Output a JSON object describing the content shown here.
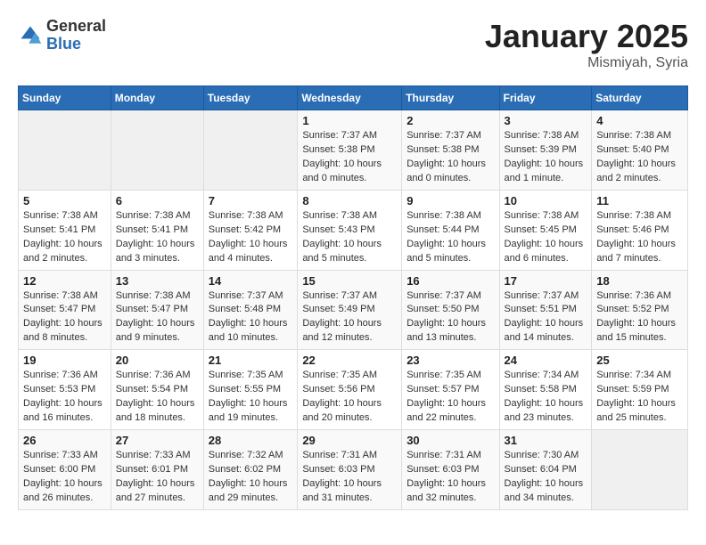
{
  "logo": {
    "general": "General",
    "blue": "Blue"
  },
  "title": "January 2025",
  "subtitle": "Mismiyah, Syria",
  "weekdays": [
    "Sunday",
    "Monday",
    "Tuesday",
    "Wednesday",
    "Thursday",
    "Friday",
    "Saturday"
  ],
  "weeks": [
    [
      {
        "empty": true
      },
      {
        "empty": true
      },
      {
        "empty": true
      },
      {
        "day": "1",
        "sunrise": "Sunrise: 7:37 AM",
        "sunset": "Sunset: 5:38 PM",
        "daylight": "Daylight: 10 hours and 0 minutes."
      },
      {
        "day": "2",
        "sunrise": "Sunrise: 7:37 AM",
        "sunset": "Sunset: 5:38 PM",
        "daylight": "Daylight: 10 hours and 0 minutes."
      },
      {
        "day": "3",
        "sunrise": "Sunrise: 7:38 AM",
        "sunset": "Sunset: 5:39 PM",
        "daylight": "Daylight: 10 hours and 1 minute."
      },
      {
        "day": "4",
        "sunrise": "Sunrise: 7:38 AM",
        "sunset": "Sunset: 5:40 PM",
        "daylight": "Daylight: 10 hours and 2 minutes."
      }
    ],
    [
      {
        "day": "5",
        "sunrise": "Sunrise: 7:38 AM",
        "sunset": "Sunset: 5:41 PM",
        "daylight": "Daylight: 10 hours and 2 minutes."
      },
      {
        "day": "6",
        "sunrise": "Sunrise: 7:38 AM",
        "sunset": "Sunset: 5:41 PM",
        "daylight": "Daylight: 10 hours and 3 minutes."
      },
      {
        "day": "7",
        "sunrise": "Sunrise: 7:38 AM",
        "sunset": "Sunset: 5:42 PM",
        "daylight": "Daylight: 10 hours and 4 minutes."
      },
      {
        "day": "8",
        "sunrise": "Sunrise: 7:38 AM",
        "sunset": "Sunset: 5:43 PM",
        "daylight": "Daylight: 10 hours and 5 minutes."
      },
      {
        "day": "9",
        "sunrise": "Sunrise: 7:38 AM",
        "sunset": "Sunset: 5:44 PM",
        "daylight": "Daylight: 10 hours and 5 minutes."
      },
      {
        "day": "10",
        "sunrise": "Sunrise: 7:38 AM",
        "sunset": "Sunset: 5:45 PM",
        "daylight": "Daylight: 10 hours and 6 minutes."
      },
      {
        "day": "11",
        "sunrise": "Sunrise: 7:38 AM",
        "sunset": "Sunset: 5:46 PM",
        "daylight": "Daylight: 10 hours and 7 minutes."
      }
    ],
    [
      {
        "day": "12",
        "sunrise": "Sunrise: 7:38 AM",
        "sunset": "Sunset: 5:47 PM",
        "daylight": "Daylight: 10 hours and 8 minutes."
      },
      {
        "day": "13",
        "sunrise": "Sunrise: 7:38 AM",
        "sunset": "Sunset: 5:47 PM",
        "daylight": "Daylight: 10 hours and 9 minutes."
      },
      {
        "day": "14",
        "sunrise": "Sunrise: 7:37 AM",
        "sunset": "Sunset: 5:48 PM",
        "daylight": "Daylight: 10 hours and 10 minutes."
      },
      {
        "day": "15",
        "sunrise": "Sunrise: 7:37 AM",
        "sunset": "Sunset: 5:49 PM",
        "daylight": "Daylight: 10 hours and 12 minutes."
      },
      {
        "day": "16",
        "sunrise": "Sunrise: 7:37 AM",
        "sunset": "Sunset: 5:50 PM",
        "daylight": "Daylight: 10 hours and 13 minutes."
      },
      {
        "day": "17",
        "sunrise": "Sunrise: 7:37 AM",
        "sunset": "Sunset: 5:51 PM",
        "daylight": "Daylight: 10 hours and 14 minutes."
      },
      {
        "day": "18",
        "sunrise": "Sunrise: 7:36 AM",
        "sunset": "Sunset: 5:52 PM",
        "daylight": "Daylight: 10 hours and 15 minutes."
      }
    ],
    [
      {
        "day": "19",
        "sunrise": "Sunrise: 7:36 AM",
        "sunset": "Sunset: 5:53 PM",
        "daylight": "Daylight: 10 hours and 16 minutes."
      },
      {
        "day": "20",
        "sunrise": "Sunrise: 7:36 AM",
        "sunset": "Sunset: 5:54 PM",
        "daylight": "Daylight: 10 hours and 18 minutes."
      },
      {
        "day": "21",
        "sunrise": "Sunrise: 7:35 AM",
        "sunset": "Sunset: 5:55 PM",
        "daylight": "Daylight: 10 hours and 19 minutes."
      },
      {
        "day": "22",
        "sunrise": "Sunrise: 7:35 AM",
        "sunset": "Sunset: 5:56 PM",
        "daylight": "Daylight: 10 hours and 20 minutes."
      },
      {
        "day": "23",
        "sunrise": "Sunrise: 7:35 AM",
        "sunset": "Sunset: 5:57 PM",
        "daylight": "Daylight: 10 hours and 22 minutes."
      },
      {
        "day": "24",
        "sunrise": "Sunrise: 7:34 AM",
        "sunset": "Sunset: 5:58 PM",
        "daylight": "Daylight: 10 hours and 23 minutes."
      },
      {
        "day": "25",
        "sunrise": "Sunrise: 7:34 AM",
        "sunset": "Sunset: 5:59 PM",
        "daylight": "Daylight: 10 hours and 25 minutes."
      }
    ],
    [
      {
        "day": "26",
        "sunrise": "Sunrise: 7:33 AM",
        "sunset": "Sunset: 6:00 PM",
        "daylight": "Daylight: 10 hours and 26 minutes."
      },
      {
        "day": "27",
        "sunrise": "Sunrise: 7:33 AM",
        "sunset": "Sunset: 6:01 PM",
        "daylight": "Daylight: 10 hours and 27 minutes."
      },
      {
        "day": "28",
        "sunrise": "Sunrise: 7:32 AM",
        "sunset": "Sunset: 6:02 PM",
        "daylight": "Daylight: 10 hours and 29 minutes."
      },
      {
        "day": "29",
        "sunrise": "Sunrise: 7:31 AM",
        "sunset": "Sunset: 6:03 PM",
        "daylight": "Daylight: 10 hours and 31 minutes."
      },
      {
        "day": "30",
        "sunrise": "Sunrise: 7:31 AM",
        "sunset": "Sunset: 6:03 PM",
        "daylight": "Daylight: 10 hours and 32 minutes."
      },
      {
        "day": "31",
        "sunrise": "Sunrise: 7:30 AM",
        "sunset": "Sunset: 6:04 PM",
        "daylight": "Daylight: 10 hours and 34 minutes."
      },
      {
        "empty": true
      }
    ]
  ]
}
